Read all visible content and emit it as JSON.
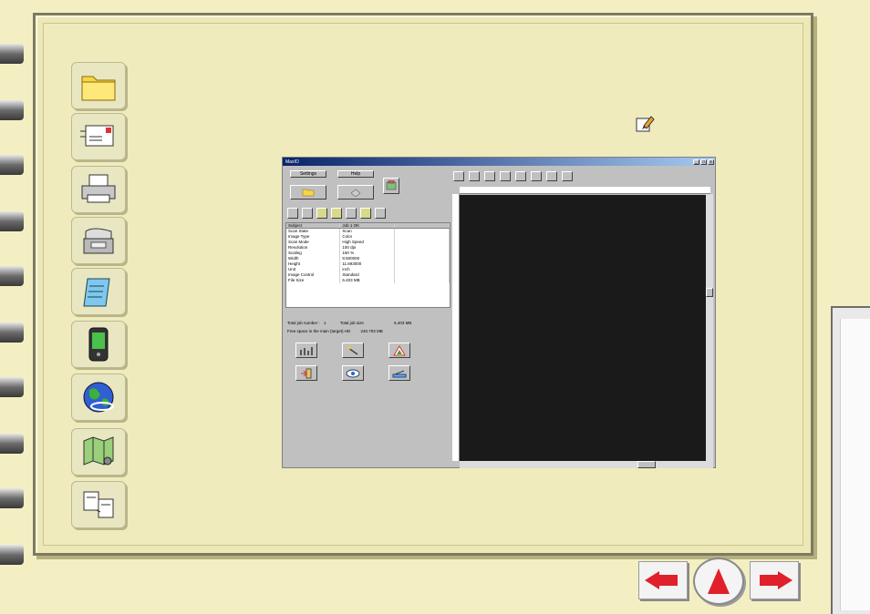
{
  "window": {
    "title": "MaxIO",
    "minimize": "_",
    "maximize": "□",
    "close": "x"
  },
  "left_buttons": {
    "settings": "Settings",
    "help": "Help"
  },
  "table": {
    "headers": [
      "Subject",
      "Job 1   OK",
      ""
    ],
    "rows": [
      [
        "Scan State",
        "Scan"
      ],
      [
        "Image Type",
        "Color"
      ],
      [
        "Scan Mode",
        "High Speed"
      ],
      [
        "Resolution",
        "100 dpi"
      ],
      [
        "Scaling",
        "150 %"
      ],
      [
        "Width",
        "8.500000"
      ],
      [
        "Height",
        "11.693000"
      ],
      [
        "Unit",
        "inch"
      ],
      [
        "Image Control",
        "Standard"
      ],
      [
        "File Size",
        "6.403   MB"
      ]
    ]
  },
  "totals": {
    "job_label": "Total job number :",
    "job_value": "1",
    "size_label": "Total job size",
    "size_value": "6.403    MB",
    "free_label": "Free space in the main (target) HD",
    "free_value": "240.703 MB"
  },
  "colors": {
    "page_bg": "#f3efc2",
    "notebook_border": "#7d7b5e",
    "nav_arrow": "#e0202a",
    "preview_bg": "#1a1a1a"
  },
  "icons": {
    "sidebar": [
      "folder-icon",
      "mail-icon",
      "printer-icon",
      "fax-icon",
      "notepad-icon",
      "pda-icon",
      "globe-icon",
      "map-icon",
      "copy-icon"
    ]
  }
}
